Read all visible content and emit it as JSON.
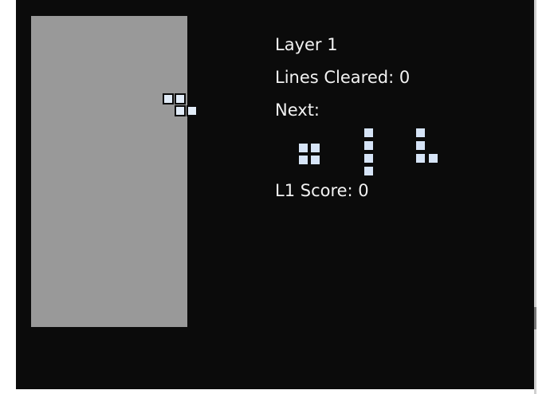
{
  "colors": {
    "window_background": "#0b0b0b",
    "board_background": "#999999",
    "block_fill": "#e2ecf8",
    "block_border": "#0b0b0b",
    "text": "#f2f2f2",
    "preview_block": "#d6e4f7"
  },
  "hud": {
    "layer_label": "Layer 1",
    "lines_cleared_label": "Lines Cleared: 0",
    "next_label": "Next:",
    "score_label": "L1 Score: 0"
  },
  "active_piece": {
    "shape": "Z",
    "icon": "z-tetromino-icon"
  },
  "next_pieces": [
    {
      "shape": "O",
      "icon": "o-tetromino-icon"
    },
    {
      "shape": "I",
      "icon": "i-tetromino-icon"
    },
    {
      "shape": "L",
      "icon": "l-tetromino-icon"
    }
  ]
}
